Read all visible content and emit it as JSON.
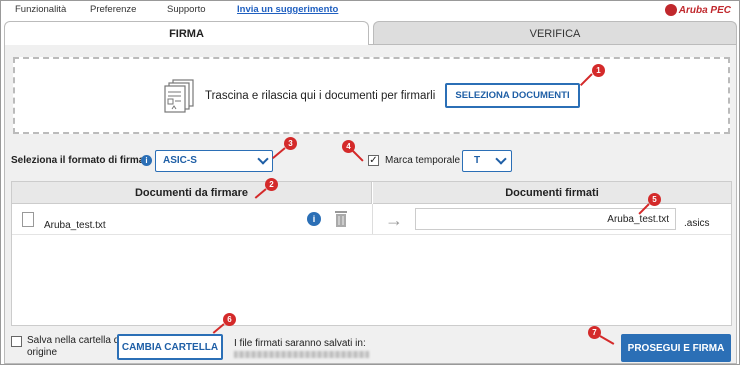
{
  "menu": {
    "items": [
      "Funzionalità",
      "Preferenze",
      "Supporto"
    ],
    "link": "Invia un suggerimento"
  },
  "brand": {
    "name": "Aruba PEC",
    "color": "#c0282d"
  },
  "tabs": {
    "firma": "FIRMA",
    "verifica": "VERIFICA"
  },
  "dropzone": {
    "text": "Trascina e rilascia qui i documenti per firmarli",
    "button": "SELEZIONA DOCUMENTI"
  },
  "format": {
    "label": "Seleziona il formato di firma",
    "value": "ASIC-S",
    "info": "i"
  },
  "timestamp": {
    "checked": true,
    "label": "Marca temporale",
    "value": "T"
  },
  "table": {
    "left_header": "Documenti da firmare",
    "right_header": "Documenti firmati",
    "rows": [
      {
        "file": "Aruba_test.txt",
        "output": "Aruba_test.txt",
        "ext": ".asics"
      }
    ]
  },
  "footer": {
    "save_origin_label": "Salva nella cartella di origine",
    "change_folder_button": "CAMBIA CARTELLA",
    "saved_in_label": "I file firmati saranno salvati in:",
    "proceed_button": "PROSEGUI E FIRMA"
  },
  "markers": [
    "1",
    "2",
    "3",
    "4",
    "5",
    "6",
    "7"
  ],
  "colors": {
    "accent": "#2b6fb6",
    "marker": "#d42a2a"
  },
  "icons": [
    "document-stack-icon",
    "info-icon",
    "chevron-down-icon",
    "file-icon",
    "trash-icon",
    "arrow-right-icon",
    "checkbox-icon"
  ]
}
